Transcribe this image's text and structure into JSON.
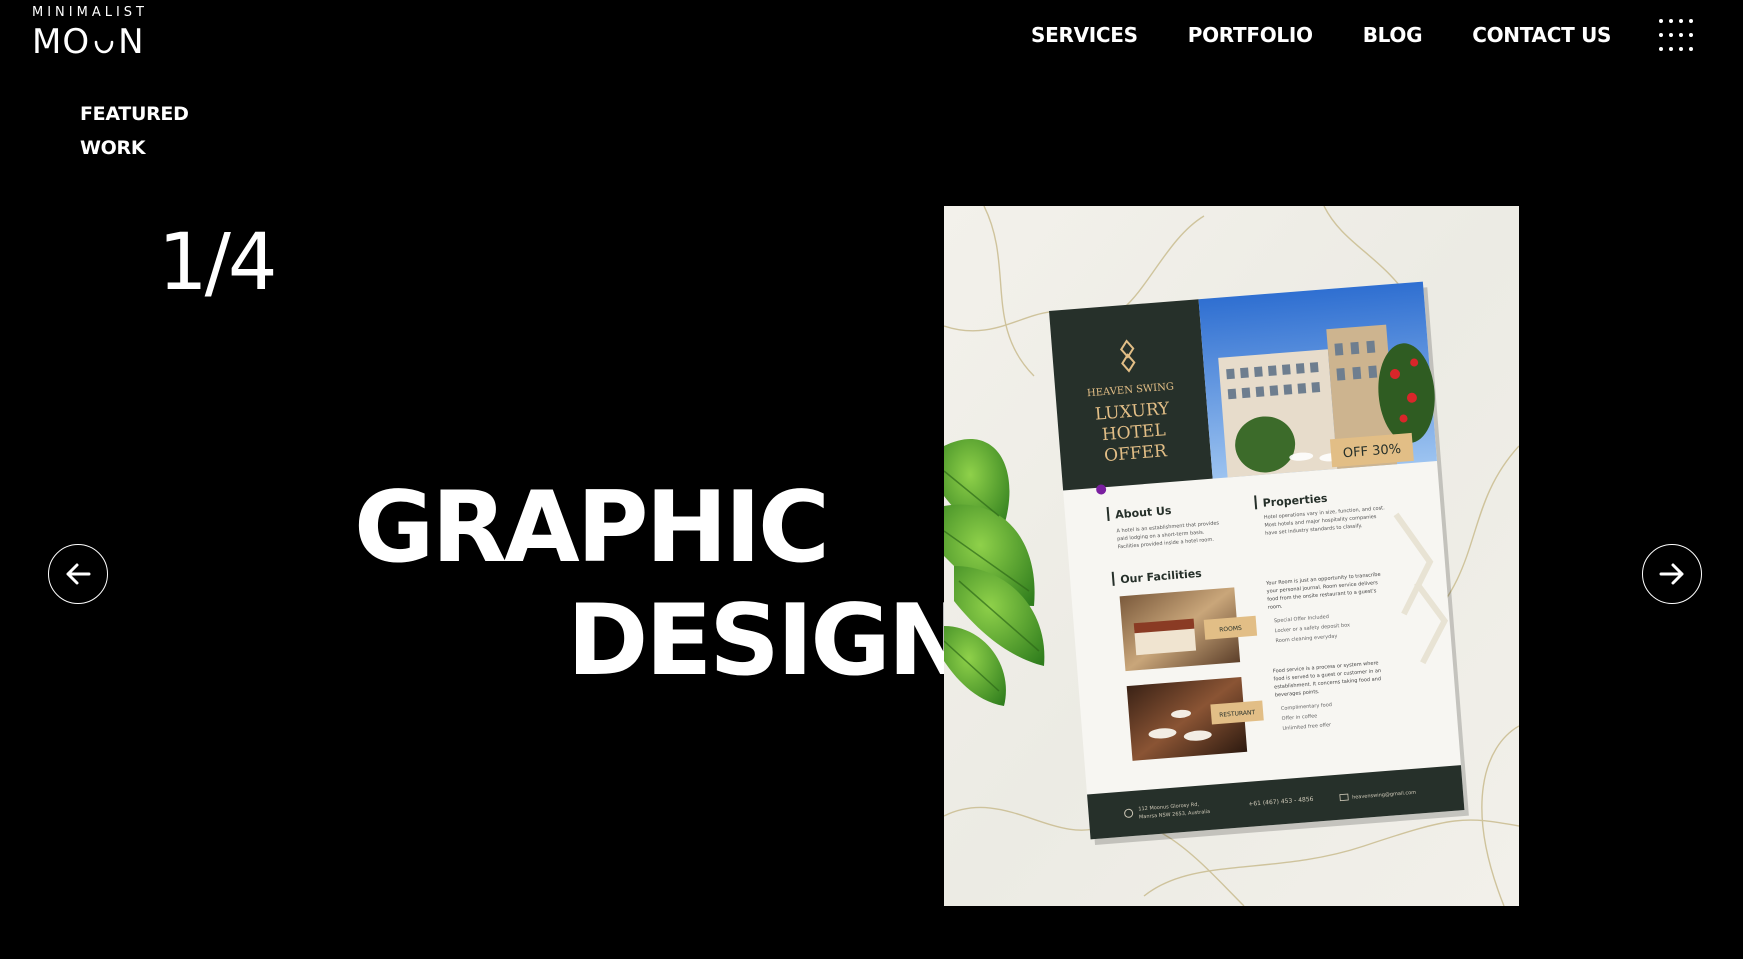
{
  "brand": {
    "small": "MINIMALIST",
    "big_left": "MO",
    "big_right": "N"
  },
  "nav": {
    "items": [
      {
        "label": "SERVICES"
      },
      {
        "label": "PORTFOLIO"
      },
      {
        "label": "BLOG"
      },
      {
        "label": "CONTACT US"
      }
    ],
    "menu_icon": "grid-dots-icon"
  },
  "featured": {
    "line1": "FEATURED",
    "line2": "WORK"
  },
  "slider": {
    "counter": "1/4",
    "title_line1": "GRAPHIC",
    "title_line2": "DESIGN",
    "prev_icon": "arrow-left-icon",
    "next_icon": "arrow-right-icon"
  },
  "flyer": {
    "brand": "HEAVEN SWING",
    "headline_1": "LUXURY",
    "headline_2": "HOTEL",
    "headline_3": "OFFER",
    "discount": "OFF 30%",
    "about_title": "About Us",
    "about_text_1": "A hotel is an establishment that provides",
    "about_text_2": "paid lodging on a short-term basis.",
    "about_text_3": "Facilities provided inside a hotel room.",
    "properties_title": "Properties",
    "properties_text_1": "Hotel operations vary in size, function, and cost.",
    "properties_text_2": "Most hotels and major hospitality companies",
    "properties_text_3": "have set industry standards to classify.",
    "facilities_title": "Our Facilities",
    "rooms_tag": "ROOMS",
    "restaurant_tag": "RESTURANT",
    "room_text_1": "Your Room is just an opportunity to transcribe",
    "room_text_2": "your personal journal. Room service delivers",
    "room_text_3": "food from the onsite restaurant to a guest's",
    "room_text_4": "room.",
    "room_bullet_1": "Special Offer Included",
    "room_bullet_2": "Locker or a safety deposit box",
    "room_bullet_3": "Room cleaning everyday",
    "food_text_1": "Food service is a process or system where",
    "food_text_2": "food is served to a guest or customer in an",
    "food_text_3": "establishment. It concerns taking food and",
    "food_text_4": "beverages points.",
    "food_bullet_1": "Complimentary food",
    "food_bullet_2": "Offer in coffee",
    "food_bullet_3": "Unlimited free offer",
    "address_1": "112 Moonus Glorosy Rd,",
    "address_2": "Manrsa NSW 2653, Australia",
    "phone": "+61 (467) 453 - 4856",
    "email": "heavenswing@gmail.com"
  },
  "colors": {
    "background": "#000000",
    "text": "#ffffff",
    "flyer_green": "#26302a",
    "flyer_gold": "#e2be86",
    "accent_purple": "#7a1fa0"
  }
}
